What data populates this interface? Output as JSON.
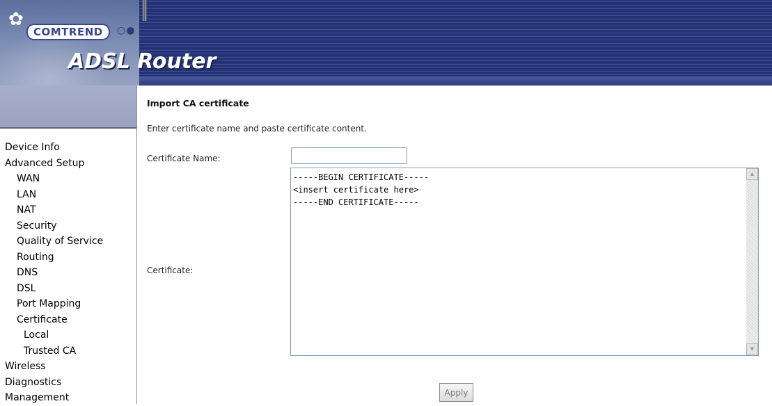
{
  "banner": {
    "brand_logo_text": "COMTREND",
    "product_title": "ADSL Router"
  },
  "sidebar": {
    "items": [
      {
        "label": "Device Info",
        "level": 0
      },
      {
        "label": "Advanced Setup",
        "level": 0
      },
      {
        "label": "WAN",
        "level": 1
      },
      {
        "label": "LAN",
        "level": 1
      },
      {
        "label": "NAT",
        "level": 1
      },
      {
        "label": "Security",
        "level": 1
      },
      {
        "label": "Quality of Service",
        "level": 1
      },
      {
        "label": "Routing",
        "level": 1
      },
      {
        "label": "DNS",
        "level": 1
      },
      {
        "label": "DSL",
        "level": 1
      },
      {
        "label": "Port Mapping",
        "level": 1
      },
      {
        "label": "Certificate",
        "level": 1
      },
      {
        "label": "Local",
        "level": 2
      },
      {
        "label": "Trusted CA",
        "level": 2
      },
      {
        "label": "Wireless",
        "level": 0
      },
      {
        "label": "Diagnostics",
        "level": 0
      },
      {
        "label": "Management",
        "level": 0
      }
    ]
  },
  "main": {
    "title": "Import CA certificate",
    "description": "Enter certificate name and paste certificate content.",
    "cert_name_label": "Certificate Name:",
    "cert_name_value": "",
    "certificate_label": "Certificate:",
    "certificate_value": "-----BEGIN CERTIFICATE-----\n<insert certificate here>\n-----END CERTIFICATE-----",
    "apply_label": "Apply"
  },
  "icons": {
    "scroll_up": "scroll-up-arrow-icon",
    "scroll_down": "scroll-down-arrow-icon"
  }
}
